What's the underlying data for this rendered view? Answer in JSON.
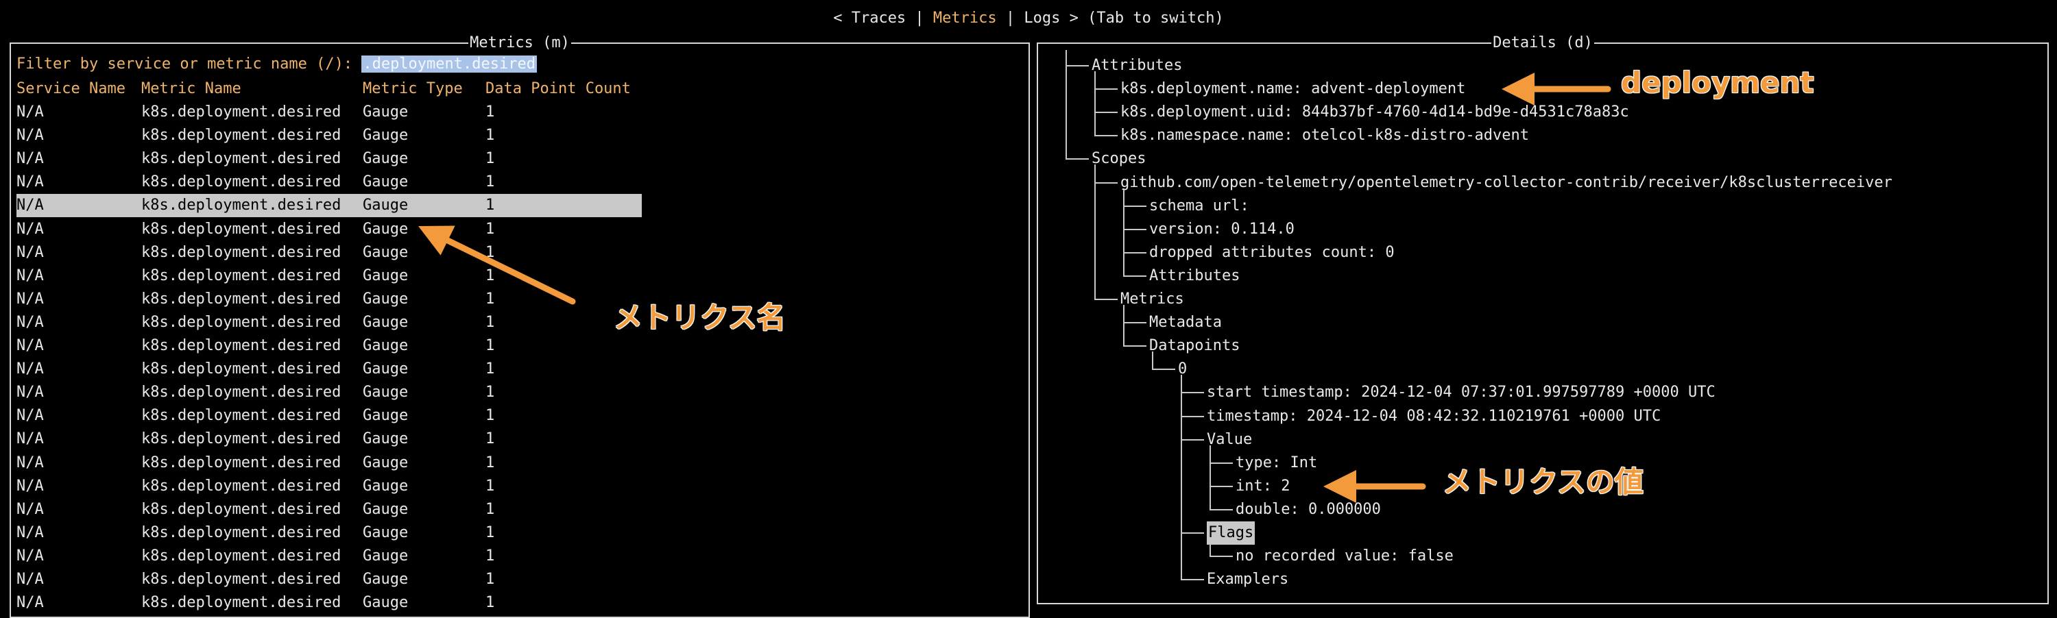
{
  "tabbar": {
    "prefix": "< Traces | ",
    "active": "Metrics",
    "suffix": " | Logs > (Tab to switch)"
  },
  "metrics_panel": {
    "title": "Metrics (m)",
    "filter_label": "Filter by service or metric name (/): ",
    "filter_value": ".deployment.desired",
    "columns": [
      "Service Name",
      "Metric Name",
      "Metric Type",
      "Data Point Count"
    ],
    "rows": [
      [
        "N/A",
        "k8s.deployment.desired",
        "Gauge",
        "1"
      ],
      [
        "N/A",
        "k8s.deployment.desired",
        "Gauge",
        "1"
      ],
      [
        "N/A",
        "k8s.deployment.desired",
        "Gauge",
        "1"
      ],
      [
        "N/A",
        "k8s.deployment.desired",
        "Gauge",
        "1"
      ],
      [
        "N/A",
        "k8s.deployment.desired",
        "Gauge",
        "1"
      ],
      [
        "N/A",
        "k8s.deployment.desired",
        "Gauge",
        "1"
      ],
      [
        "N/A",
        "k8s.deployment.desired",
        "Gauge",
        "1"
      ],
      [
        "N/A",
        "k8s.deployment.desired",
        "Gauge",
        "1"
      ],
      [
        "N/A",
        "k8s.deployment.desired",
        "Gauge",
        "1"
      ],
      [
        "N/A",
        "k8s.deployment.desired",
        "Gauge",
        "1"
      ],
      [
        "N/A",
        "k8s.deployment.desired",
        "Gauge",
        "1"
      ],
      [
        "N/A",
        "k8s.deployment.desired",
        "Gauge",
        "1"
      ],
      [
        "N/A",
        "k8s.deployment.desired",
        "Gauge",
        "1"
      ],
      [
        "N/A",
        "k8s.deployment.desired",
        "Gauge",
        "1"
      ],
      [
        "N/A",
        "k8s.deployment.desired",
        "Gauge",
        "1"
      ],
      [
        "N/A",
        "k8s.deployment.desired",
        "Gauge",
        "1"
      ],
      [
        "N/A",
        "k8s.deployment.desired",
        "Gauge",
        "1"
      ],
      [
        "N/A",
        "k8s.deployment.desired",
        "Gauge",
        "1"
      ],
      [
        "N/A",
        "k8s.deployment.desired",
        "Gauge",
        "1"
      ],
      [
        "N/A",
        "k8s.deployment.desired",
        "Gauge",
        "1"
      ],
      [
        "N/A",
        "k8s.deployment.desired",
        "Gauge",
        "1"
      ],
      [
        "N/A",
        "k8s.deployment.desired",
        "Gauge",
        "1"
      ]
    ],
    "selected_row": 4
  },
  "details_panel": {
    "title": "Details (d)",
    "tree": [
      {
        "text": "Attributes",
        "depth": 0
      },
      {
        "text": "k8s.deployment.name: advent-deployment",
        "depth": 1
      },
      {
        "text": "k8s.deployment.uid: 844b37bf-4760-4d14-bd9e-d4531c78a83c",
        "depth": 1
      },
      {
        "text": "k8s.namespace.name: otelcol-k8s-distro-advent",
        "depth": 1
      },
      {
        "text": "Scopes",
        "depth": 0
      },
      {
        "text": "github.com/open-telemetry/opentelemetry-collector-contrib/receiver/k8sclusterreceiver",
        "depth": 1
      },
      {
        "text": "schema url:",
        "depth": 2
      },
      {
        "text": "version: 0.114.0",
        "depth": 2
      },
      {
        "text": "dropped attributes count: 0",
        "depth": 2
      },
      {
        "text": "Attributes",
        "depth": 2
      },
      {
        "text": "Metrics",
        "depth": 1
      },
      {
        "text": "Metadata",
        "depth": 2
      },
      {
        "text": "Datapoints",
        "depth": 2
      },
      {
        "text": "0",
        "depth": 3
      },
      {
        "text": "start timestamp: 2024-12-04 07:37:01.997597789 +0000 UTC",
        "depth": 4
      },
      {
        "text": "timestamp: 2024-12-04 08:42:32.110219761 +0000 UTC",
        "depth": 4
      },
      {
        "text": "Value",
        "depth": 4
      },
      {
        "text": "type: Int",
        "depth": 5
      },
      {
        "text": "int: 2",
        "depth": 5
      },
      {
        "text": "double: 0.000000",
        "depth": 5
      },
      {
        "text": "Flags",
        "depth": 4,
        "highlight": true
      },
      {
        "text": "no recorded value: false",
        "depth": 5
      },
      {
        "text": "Examplers",
        "depth": 4
      }
    ]
  },
  "annotations": {
    "metric_name_label": "メトリクス名",
    "deployment_label": "deployment",
    "metric_value_label": "メトリクスの値",
    "arrow_color": "#f29a3c"
  }
}
